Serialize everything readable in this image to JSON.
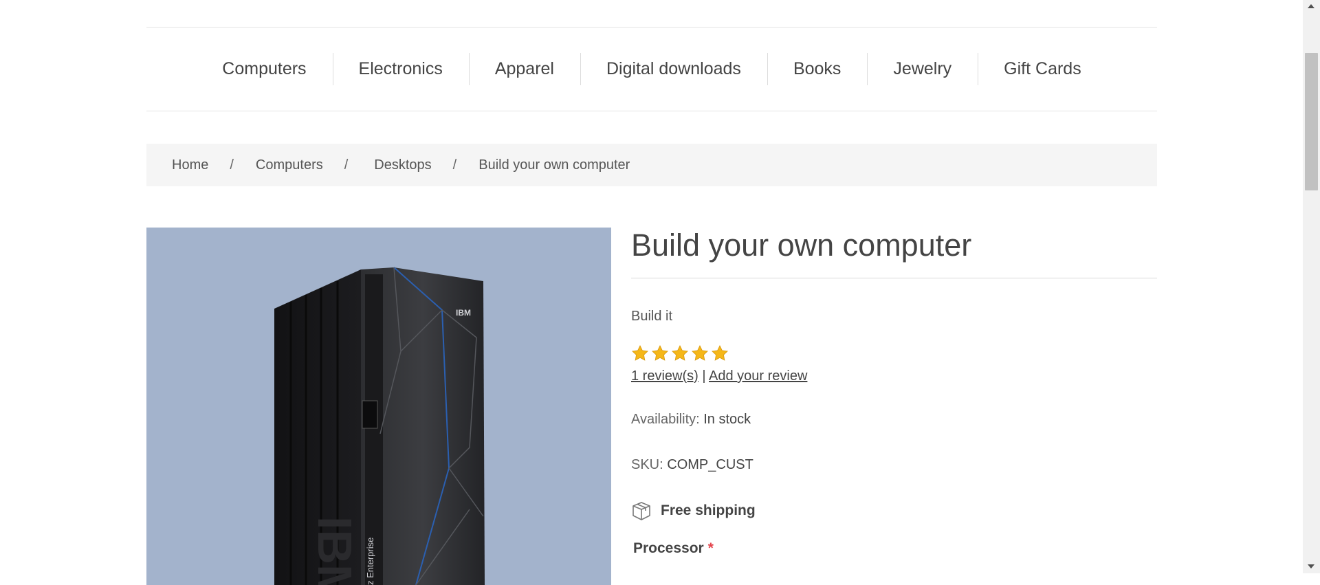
{
  "menu": {
    "items": [
      {
        "label": "Computers"
      },
      {
        "label": "Electronics"
      },
      {
        "label": "Apparel"
      },
      {
        "label": "Digital downloads"
      },
      {
        "label": "Books"
      },
      {
        "label": "Jewelry"
      },
      {
        "label": "Gift Cards"
      }
    ]
  },
  "breadcrumb": {
    "items": [
      {
        "label": "Home"
      },
      {
        "label": "Computers"
      },
      {
        "label": "Desktops"
      }
    ],
    "separator": "/",
    "current": "Build your own computer"
  },
  "product": {
    "title": "Build your own computer",
    "short_description": "Build it",
    "rating": {
      "value": 5,
      "max": 5,
      "star_color": "#f5b718"
    },
    "reviews_link": "1 review(s)",
    "review_separator": "|",
    "add_review_link": "Add your review",
    "availability": {
      "label": "Availability:",
      "value": "In stock"
    },
    "sku": {
      "label": "SKU:",
      "value": "COMP_CUST"
    },
    "shipping": {
      "icon": "box-icon",
      "label": "Free shipping"
    },
    "attribute": {
      "label": "Processor",
      "required_mark": "*"
    },
    "image": {
      "alt": "IBM z Enterprise server",
      "background": "#a3b3cc",
      "brand_text": "IBM",
      "side_text": "z Enterprise"
    }
  }
}
